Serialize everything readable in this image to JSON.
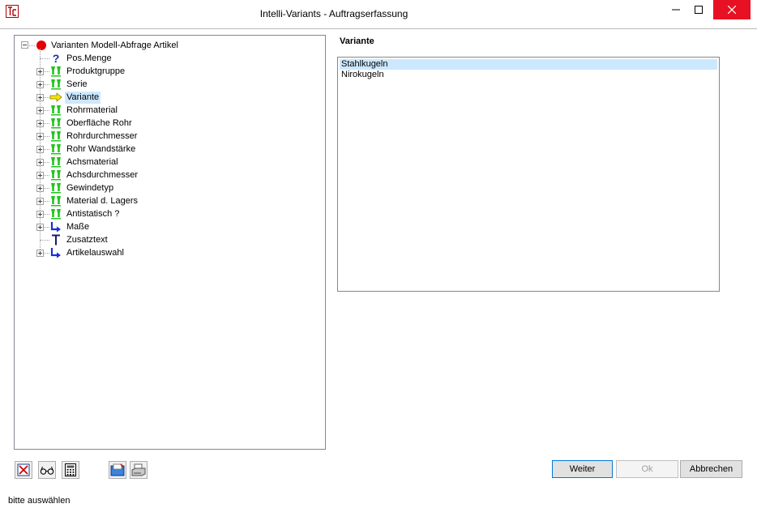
{
  "window": {
    "title": "Intelli-Variants - Auftragserfassung"
  },
  "tree": {
    "root_label": "Varianten Modell-Abfrage Artikel",
    "items": [
      {
        "label": "Pos.Menge",
        "icon": "question-icon",
        "expandable": false
      },
      {
        "label": "Produktgruppe",
        "icon": "green-filter-icon",
        "expandable": true
      },
      {
        "label": "Serie",
        "icon": "green-filter-icon",
        "expandable": true
      },
      {
        "label": "Variante",
        "icon": "yellow-arrow-icon",
        "expandable": true,
        "selected": true
      },
      {
        "label": "Rohrmaterial",
        "icon": "green-filter-icon",
        "expandable": true
      },
      {
        "label": "Oberfläche Rohr",
        "icon": "green-filter-icon",
        "expandable": true
      },
      {
        "label": "Rohrdurchmesser",
        "icon": "green-filter-icon",
        "expandable": true
      },
      {
        "label": "Rohr Wandstärke",
        "icon": "green-filter-icon",
        "expandable": true
      },
      {
        "label": "Achsmaterial",
        "icon": "green-filter-icon",
        "expandable": true
      },
      {
        "label": "Achsdurchmesser",
        "icon": "green-filter-icon",
        "expandable": true
      },
      {
        "label": "Gewindetyp",
        "icon": "green-filter-icon",
        "expandable": true
      },
      {
        "label": "Material d. Lagers",
        "icon": "green-filter-icon",
        "expandable": true
      },
      {
        "label": "Antistatisch ?",
        "icon": "green-filter-icon",
        "expandable": true
      },
      {
        "label": "Maße",
        "icon": "blue-corner-arrow-icon",
        "expandable": true
      },
      {
        "label": "Zusatztext",
        "icon": "text-t-icon",
        "expandable": false
      },
      {
        "label": "Artikelauswahl",
        "icon": "blue-corner-arrow-icon",
        "expandable": true
      }
    ]
  },
  "variant_panel": {
    "title": "Variante",
    "options": [
      "Stahlkugeln",
      "Nirokugeln"
    ],
    "selected_index": 0
  },
  "buttons": {
    "weiter": "Weiter",
    "ok": "Ok",
    "abbrechen": "Abbrechen"
  },
  "status": {
    "text": "bitte auswählen"
  },
  "colors": {
    "selection": "#cce8ff",
    "close_button": "#e81123",
    "filter_green": "#22c41e",
    "arrow_yellow": "#f5e500",
    "corner_blue": "#1530d6",
    "root_red": "#e40000"
  }
}
